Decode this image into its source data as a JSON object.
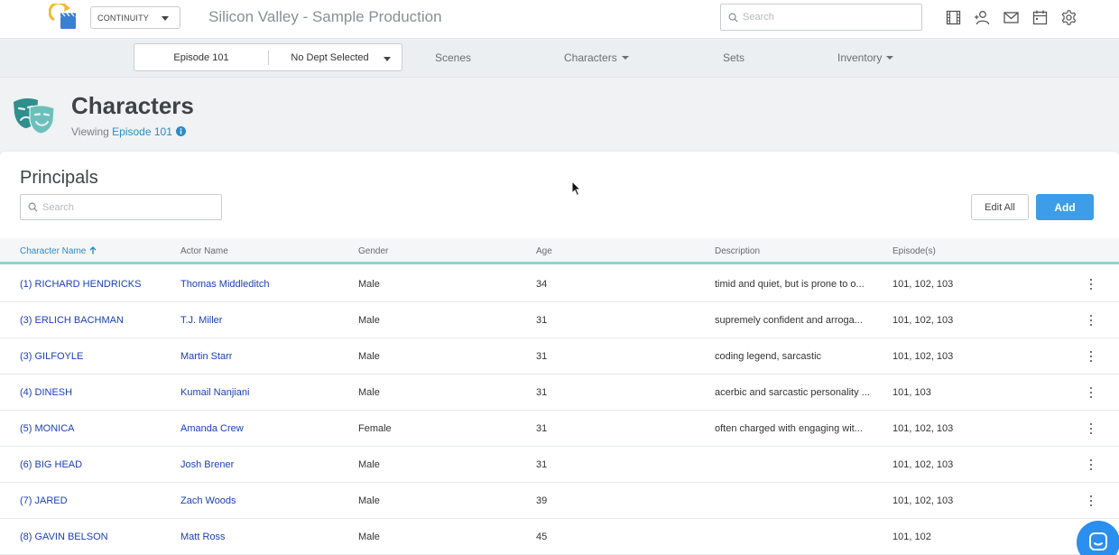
{
  "app": {
    "module_select": "CONTINUITY",
    "production_title": "Silicon Valley - Sample Production",
    "search_placeholder": "Search",
    "top_icons": [
      "film-strip-icon",
      "add-user-icon",
      "mail-icon",
      "calendar-icon",
      "gear-icon"
    ]
  },
  "subnav": {
    "episode": "Episode 101",
    "department": "No Dept Selected",
    "items": [
      {
        "label": "Scenes",
        "dropdown": false
      },
      {
        "label": "Characters",
        "dropdown": true
      },
      {
        "label": "Sets",
        "dropdown": false
      },
      {
        "label": "Inventory",
        "dropdown": true
      }
    ]
  },
  "page": {
    "title": "Characters",
    "viewing_prefix": "Viewing",
    "viewing_episode": "Episode 101"
  },
  "section": {
    "title": "Principals",
    "search_placeholder": "Search",
    "edit_all_label": "Edit All",
    "add_label": "Add"
  },
  "table": {
    "columns": [
      "Character Name",
      "Actor Name",
      "Gender",
      "Age",
      "Description",
      "Episode(s)"
    ],
    "sorted_column": "Character Name",
    "rows": [
      {
        "character": "(1) RICHARD HENDRICKS",
        "actor": "Thomas Middleditch",
        "gender": "Male",
        "age": "34",
        "description": "timid and quiet, but is prone to o...",
        "episodes": "101, 102, 103"
      },
      {
        "character": "(3) ERLICH BACHMAN",
        "actor": "T.J. Miller",
        "gender": "Male",
        "age": "31",
        "description": "supremely confident and arroga...",
        "episodes": "101, 102, 103"
      },
      {
        "character": "(3) GILFOYLE",
        "actor": "Martin Starr",
        "gender": "Male",
        "age": "31",
        "description": "coding legend, sarcastic",
        "episodes": "101, 102, 103"
      },
      {
        "character": "(4) DINESH",
        "actor": "Kumail Nanjiani",
        "gender": "Male",
        "age": "31",
        "description": "acerbic and sarcastic personality ...",
        "episodes": "101, 103"
      },
      {
        "character": "(5) MONICA",
        "actor": "Amanda Crew",
        "gender": "Female",
        "age": "31",
        "description": "often charged with engaging wit...",
        "episodes": "101, 102, 103"
      },
      {
        "character": "(6) BIG HEAD",
        "actor": "Josh Brener",
        "gender": "Male",
        "age": "31",
        "description": "",
        "episodes": "101, 102, 103"
      },
      {
        "character": "(7) JARED",
        "actor": "Zach Woods",
        "gender": "Male",
        "age": "39",
        "description": "",
        "episodes": "101, 102, 103"
      },
      {
        "character": "(8) GAVIN BELSON",
        "actor": "Matt Ross",
        "gender": "Male",
        "age": "45",
        "description": "",
        "episodes": "101, 102"
      }
    ]
  },
  "colors": {
    "accent_blue": "#3d9de8",
    "link_blue": "#1a3fb8",
    "teal_rule": "#8fd3cf",
    "mask_teal": "#2f8f8c"
  }
}
